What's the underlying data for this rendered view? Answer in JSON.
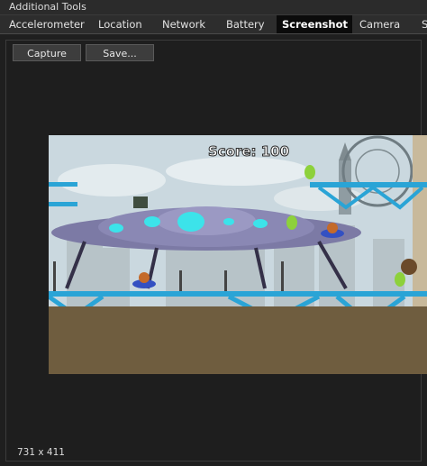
{
  "window": {
    "title": "Additional Tools"
  },
  "tabs": [
    {
      "label": "Accelerometer"
    },
    {
      "label": "Location"
    },
    {
      "label": "Network"
    },
    {
      "label": "Battery"
    },
    {
      "label": "Screenshot"
    },
    {
      "label": "Camera"
    },
    {
      "label": "S"
    }
  ],
  "active_tab": "Screenshot",
  "toolbar": {
    "capture_label": "Capture",
    "save_label": "Save..."
  },
  "screenshot": {
    "score_text": "Score: 100",
    "dimensions": "731 x 411"
  }
}
